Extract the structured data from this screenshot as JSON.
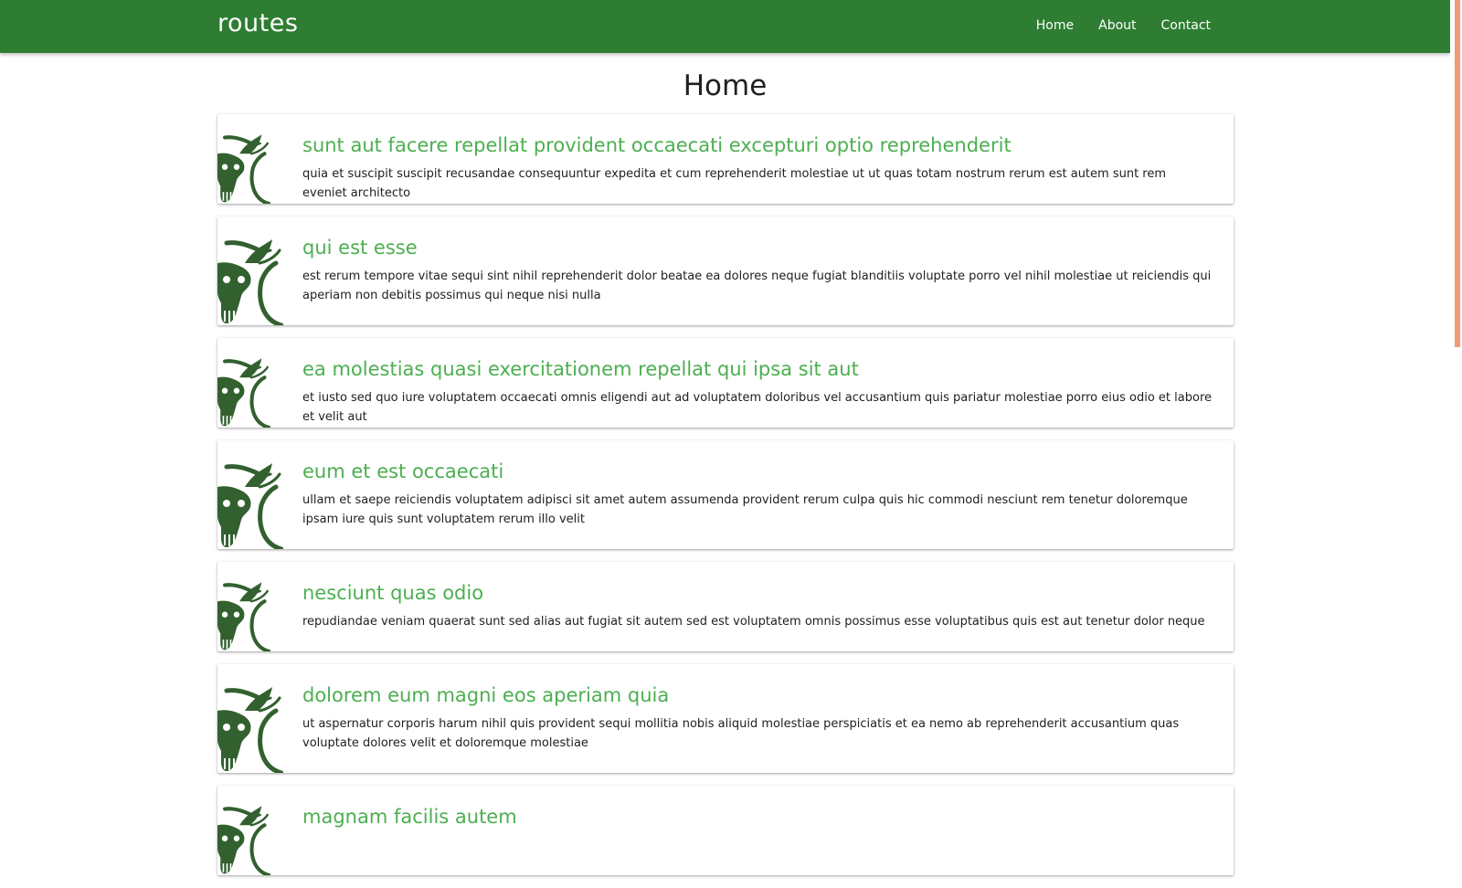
{
  "navbar": {
    "brand": "routes",
    "links": [
      "Home",
      "About",
      "Contact"
    ]
  },
  "page": {
    "title": "Home"
  },
  "posts": [
    {
      "title": "sunt aut facere repellat provident occaecati excepturi optio reprehenderit",
      "body": "quia et suscipit suscipit recusandae consequuntur expedita et cum reprehenderit molestiae ut ut quas totam nostrum rerum est autem sunt rem eveniet architecto"
    },
    {
      "title": "qui est esse",
      "body": "est rerum tempore vitae sequi sint nihil reprehenderit dolor beatae ea dolores neque fugiat blanditiis voluptate porro vel nihil molestiae ut reiciendis qui aperiam non debitis possimus qui neque nisi nulla"
    },
    {
      "title": "ea molestias quasi exercitationem repellat qui ipsa sit aut",
      "body": "et iusto sed quo iure voluptatem occaecati omnis eligendi aut ad voluptatem doloribus vel accusantium quis pariatur molestiae porro eius odio et labore et velit aut"
    },
    {
      "title": "eum et est occaecati",
      "body": "ullam et saepe reiciendis voluptatem adipisci sit amet autem assumenda provident rerum culpa quis hic commodi nesciunt rem tenetur doloremque ipsam iure quis sunt voluptatem rerum illo velit"
    },
    {
      "title": "nesciunt quas odio",
      "body": "repudiandae veniam quaerat sunt sed alias aut fugiat sit autem sed est voluptatem omnis possimus esse voluptatibus quis est aut tenetur dolor neque"
    },
    {
      "title": "dolorem eum magni eos aperiam quia",
      "body": "ut aspernatur corporis harum nihil quis provident sequi mollitia nobis aliquid molestiae perspiciatis et ea nemo ab reprehenderit accusantium quas voluptate dolores velit et doloremque molestiae"
    },
    {
      "title": "magnam facilis autem",
      "body": ""
    }
  ],
  "icons": {
    "card_icon": "deer-skull-icon"
  },
  "colors": {
    "navbar": "#2e7d32",
    "title": "#4caf50",
    "icon": "#33602f",
    "scrollbar_thumb": "#ef9a7a"
  }
}
